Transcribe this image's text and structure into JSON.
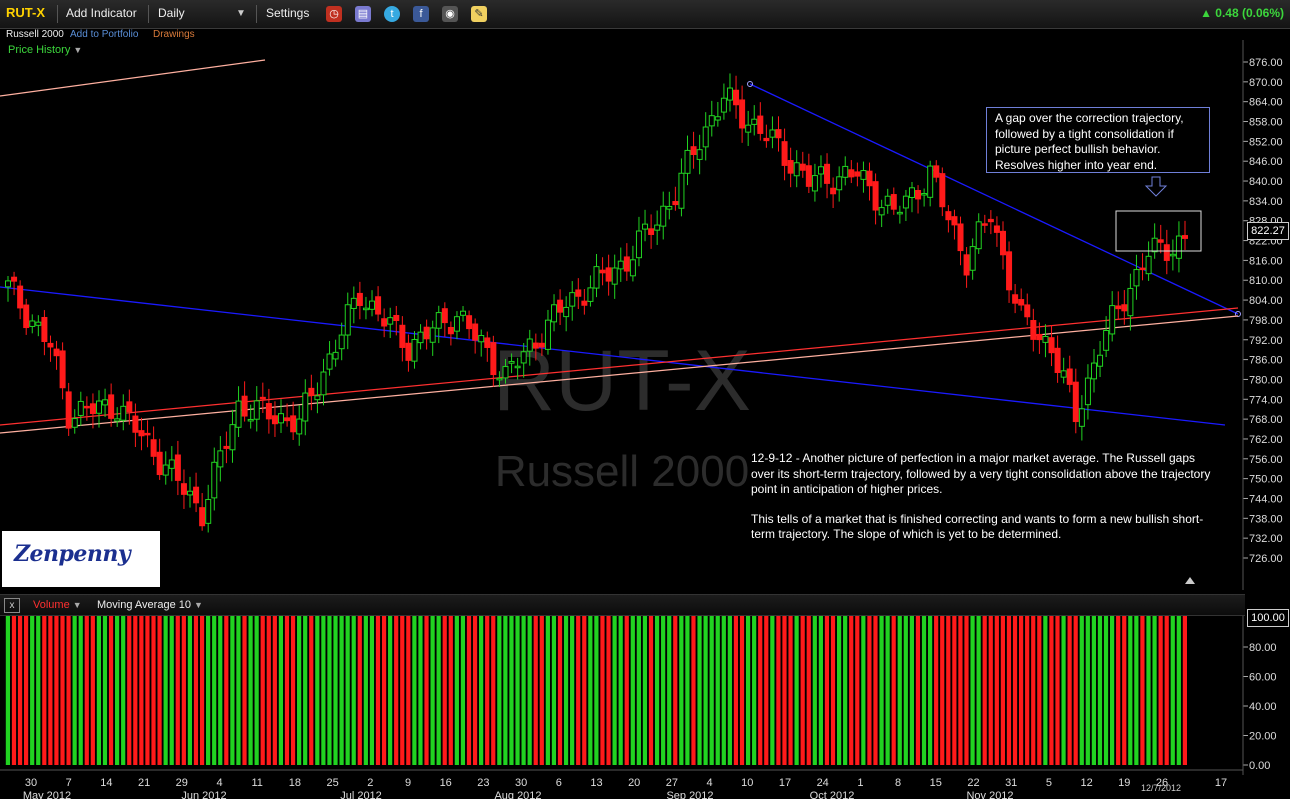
{
  "toolbar": {
    "symbol": "RUT-X",
    "add_indicator": "Add Indicator",
    "period": "Daily",
    "settings": "Settings",
    "change": "0.48 (0.06%)"
  },
  "subbar": {
    "name": "Russell 2000",
    "add_portfolio": "Add to Portfolio",
    "drawings": "Drawings"
  },
  "price_panel": {
    "label": "Price History",
    "watermark_symbol": "RUT-X",
    "watermark_name": "Russell 2000",
    "last_price": "822.27",
    "annotation": "A gap over the correction trajectory, followed by a tight consolidation if picture perfect bullish behavior. Resolves higher into year end.",
    "commentary_1": "12-9-12 - Another picture of perfection in a major market average. The Russell gaps over its short-term trajectory, followed by a very tight consolidation above the trajectory point in anticipation of higher prices.",
    "commentary_2": "This tells of a market that is finished correcting and wants to form a new bullish short-term trajectory. The slope of which is yet to be determined.",
    "logo_text": "Zenpenny",
    "y_ticks": [
      "876.00",
      "870.00",
      "864.00",
      "858.00",
      "852.00",
      "846.00",
      "840.00",
      "834.00",
      "828.00",
      "822.00",
      "816.00",
      "810.00",
      "804.00",
      "798.00",
      "792.00",
      "786.00",
      "780.00",
      "774.00",
      "768.00",
      "762.00",
      "756.00",
      "750.00",
      "744.00",
      "738.00",
      "732.00",
      "726.00"
    ]
  },
  "volume_panel": {
    "label": "Volume",
    "ma_label": "Moving Average 10",
    "last_value": "100.00",
    "y_ticks": [
      "80.00",
      "60.00",
      "40.00",
      "20.00",
      "0.00"
    ]
  },
  "x_axis": {
    "days": [
      "30",
      "7",
      "14",
      "21",
      "29",
      "4",
      "11",
      "18",
      "25",
      "2",
      "9",
      "16",
      "23",
      "30",
      "6",
      "13",
      "20",
      "27",
      "4",
      "10",
      "17",
      "24",
      "1",
      "8",
      "15",
      "22",
      "31",
      "5",
      "12",
      "19",
      "26",
      "17"
    ],
    "months": [
      "May 2012",
      "Jun 2012",
      "Jul 2012",
      "Aug 2012",
      "Sep 2012",
      "Oct 2012",
      "Nov 2012"
    ],
    "last_date": "12/7/2012"
  },
  "colors": {
    "up": "#21d321",
    "down": "#ff1a1a",
    "trendline": "#1a1aff",
    "support": "#ff6060",
    "accent": "#ffd200"
  },
  "chart_data": {
    "type": "candlestick",
    "title": "RUT-X",
    "series_name": "Russell 2000",
    "x_range": [
      "2012-05-30",
      "2012-12-17"
    ],
    "ylim": [
      723,
      879
    ],
    "grid": false,
    "annotated_closes": [
      {
        "date": "2012-06-04",
        "close": 737
      },
      {
        "date": "2012-09-14",
        "close": 864
      },
      {
        "date": "2012-11-16",
        "close": 769
      },
      {
        "date": "2012-12-07",
        "close": 822.27
      }
    ]
  }
}
